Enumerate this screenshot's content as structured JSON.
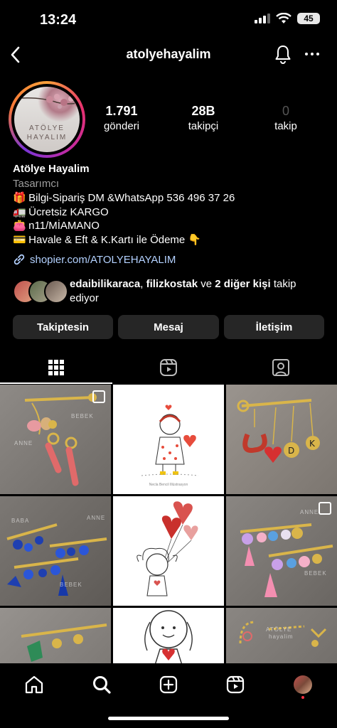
{
  "status_bar": {
    "time": "13:24",
    "battery": "45",
    "icons": [
      "signal-icon",
      "wifi-icon",
      "battery-icon"
    ]
  },
  "header": {
    "username": "atolyehayalim",
    "icons": [
      "back-chevron-icon",
      "bell-icon",
      "more-icon"
    ]
  },
  "avatar": {
    "line1": "ATÖLYE",
    "line2": "HAYALIM"
  },
  "stats": [
    {
      "value": "1.791",
      "label": "gönderi"
    },
    {
      "value": "28B",
      "label": "takipçi"
    },
    {
      "value": "0",
      "label": "takip"
    }
  ],
  "profile": {
    "name": "Atölye Hayalim",
    "category": "Tasarımcı",
    "bio": [
      {
        "emoji": "🎁",
        "text": "Bilgi-Sipariş DM &WhatsApp 536 496 37 26"
      },
      {
        "emoji": "🚛",
        "text": "Ücretsiz KARGO"
      },
      {
        "emoji": "👛",
        "text": "n11/MİAMANO"
      },
      {
        "emoji": "💳",
        "text": "Havale & Eft & K.Kartı ile Ödeme 👇"
      }
    ],
    "link": "shopier.com/ATOLYEHAYALIM"
  },
  "followed_by": {
    "user1": "edaibilikaraca",
    "sep": ",",
    "user2": "filizkostak",
    "and": "ve",
    "others": "2 diğer kişi",
    "suffix": "takip ediyor"
  },
  "buttons": {
    "following": "Takiptesin",
    "message": "Mesaj",
    "contact": "İletişim"
  },
  "tabs": [
    "grid-icon",
    "reels-icon",
    "tagged-icon"
  ],
  "grid_posts": [
    {
      "kind": "jewelry",
      "words": [
        "BEBEK",
        "ANNE"
      ]
    },
    {
      "kind": "drawing",
      "caption": "Necla Bencil Illüstrasyon"
    },
    {
      "kind": "jewelry",
      "words": []
    },
    {
      "kind": "jewelry",
      "words": [
        "BABA",
        "ANNE",
        "BEBEK"
      ]
    },
    {
      "kind": "drawing",
      "caption": ""
    },
    {
      "kind": "jewelry",
      "words": [
        "ANNE",
        "BEBEK"
      ]
    },
    {
      "kind": "jewelry",
      "words": []
    },
    {
      "kind": "drawing",
      "caption": ""
    },
    {
      "kind": "jewelry",
      "words": [
        "ATÖLYE",
        "hayalim"
      ]
    }
  ],
  "bottom_nav": [
    "home-icon",
    "search-icon",
    "create-icon",
    "reels-icon",
    "profile-avatar"
  ],
  "colors": {
    "link": "#b3d1ff",
    "button_bg": "#262626",
    "muted": "#9e9e9e"
  }
}
